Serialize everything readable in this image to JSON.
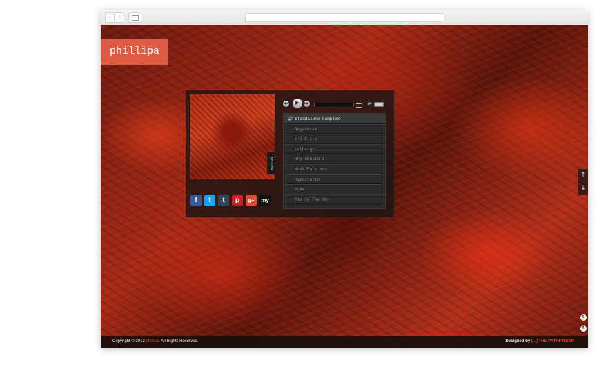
{
  "browser": {
    "back_glyph": "‹",
    "forward_glyph": "›"
  },
  "site": {
    "logo": "phillipa"
  },
  "album": {
    "tag": "phillipa"
  },
  "social": [
    {
      "name": "facebook-icon",
      "glyph": "f",
      "color": "#3b5998"
    },
    {
      "name": "twitter-icon",
      "glyph": "t",
      "color": "#1da1f2"
    },
    {
      "name": "tumblr-icon",
      "glyph": "t",
      "color": "#35465c"
    },
    {
      "name": "pinterest-icon",
      "glyph": "p",
      "color": "#cb2027"
    },
    {
      "name": "google-plus-icon",
      "glyph": "g+",
      "color": "#dd4b39"
    },
    {
      "name": "myspace-icon",
      "glyph": "my",
      "color": "#111111"
    }
  ],
  "player": {
    "prev_glyph": "◀◀",
    "play_glyph": "▶",
    "next_glyph": "▶▶",
    "volume_glyph": "🔈"
  },
  "playlist": {
    "speaker_glyph": "🔊",
    "tracks": [
      "Standalone Complex",
      "Negaverse",
      "I's & I's",
      "Lethargy",
      "Why Should I",
      "What Eats You",
      "Hypocretin",
      "Yoke",
      "Pie In The Sky"
    ]
  },
  "side": {
    "up_glyph": "↑",
    "down_glyph": "↓",
    "twitter_glyph": "t",
    "facebook_glyph": "f"
  },
  "footer": {
    "copyright_prefix": "Copyright © 2012",
    "copyright_brand": "phillipa",
    "copyright_suffix": ". All Rights Reserved.",
    "designed_by": "Designed by",
    "designer": "[...] THE PATHFINDER"
  },
  "colors": {
    "accent": "#e0472b",
    "logo_bg": "#dd5a43"
  }
}
